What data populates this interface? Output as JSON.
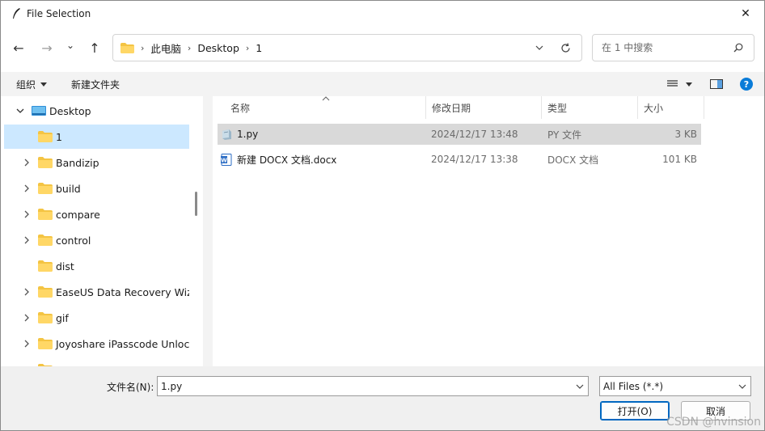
{
  "window": {
    "title": "File Selection",
    "close_glyph": "✕"
  },
  "nav": {
    "back_glyph": "←",
    "forward_glyph": "→",
    "recent_glyph": "⌄",
    "up_glyph": "↑"
  },
  "address": {
    "crumbs": [
      "此电脑",
      "Desktop",
      "1"
    ],
    "separator": "›"
  },
  "search": {
    "placeholder": "在 1 中搜索"
  },
  "toolbar": {
    "organize": "组织",
    "new_folder": "新建文件夹"
  },
  "tree": {
    "items": [
      {
        "label": "Desktop",
        "expanded": true
      },
      {
        "label": "1",
        "selected": true
      },
      {
        "label": "Bandizip"
      },
      {
        "label": "build"
      },
      {
        "label": "compare"
      },
      {
        "label": "control"
      },
      {
        "label": "dist"
      },
      {
        "label": "EaseUS Data Recovery Wizard"
      },
      {
        "label": "gif"
      },
      {
        "label": "Joyoshare iPasscode Unlocker"
      }
    ]
  },
  "columns": {
    "name": "名称",
    "modified": "修改日期",
    "type": "类型",
    "size": "大小"
  },
  "files": [
    {
      "name": "1.py",
      "modified": "2024/12/17 13:48",
      "type": "PY 文件",
      "size": "3 KB",
      "icon": "python-file-icon",
      "selected": true
    },
    {
      "name": "新建 DOCX 文档.docx",
      "modified": "2024/12/17 13:38",
      "type": "DOCX 文档",
      "size": "101 KB",
      "icon": "word-document-icon"
    }
  ],
  "bottom": {
    "filename_label": "文件名(N):",
    "filename_value": "1.py",
    "filter_value": "All Files (*.*)",
    "open_label": "打开(O)",
    "cancel_label": "取消"
  },
  "watermark": "CSDN @hvinsion",
  "colors": {
    "accent": "#0067c0",
    "selection_tree": "#cce8ff",
    "selection_list": "#d9d9d9",
    "folder": "#f4c443",
    "help": "#0a7cd8"
  }
}
